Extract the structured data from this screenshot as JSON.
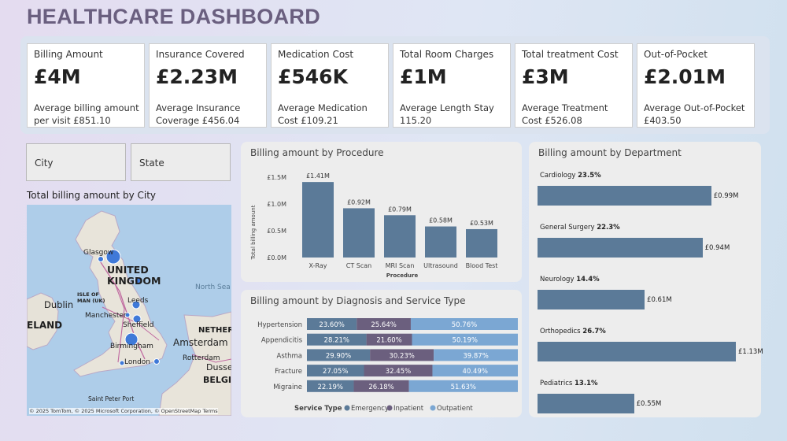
{
  "title": "HEALTHCARE DASHBOARD",
  "colors": {
    "bar": "#5b7a98",
    "emergency": "#5b7a98",
    "inpatient": "#6b5f7e",
    "outpatient": "#7ba7d3"
  },
  "kpis": [
    {
      "label": "Billing Amount",
      "value": "£4M",
      "sub": "Average billing amount per visit £851.10"
    },
    {
      "label": "Insurance Covered",
      "value": "£2.23M",
      "sub": "Average Insurance Coverage £456.04"
    },
    {
      "label": "Medication Cost",
      "value": "£546K",
      "sub": "Average Medication Cost £109.21"
    },
    {
      "label": "Total Room Charges",
      "value": "£1M",
      "sub": "Average Length Stay 115.20"
    },
    {
      "label": "Total treatment Cost",
      "value": "£3M",
      "sub": "Average Treatment Cost £526.08"
    },
    {
      "label": "Out-of-Pocket",
      "value": "£2.01M",
      "sub": "Average Out-of-Pocket £403.50"
    }
  ],
  "slicers": {
    "city": "City",
    "state": "State"
  },
  "map": {
    "title": "Total billing amount by City",
    "country": "UNITED KINGDOM",
    "labels": [
      "Glasgow",
      "Leeds",
      "Manchester",
      "Sheffield",
      "Birmingham",
      "London",
      "Dublin",
      "ISLE OF MAN (UK)",
      "North Sea",
      "NETHER",
      "Amsterdam",
      "Rotterdam",
      "Dusse",
      "BELGI",
      "ELAND",
      "Saint Peter Port"
    ],
    "attribution": "© 2025 TomTom, © 2025 Microsoft Corporation, © OpenStreetMap Terms"
  },
  "procedure_chart": {
    "title": "Billing amount by Procedure",
    "xlabel": "Procedure",
    "ylabel": "Total billing amount",
    "ticks": [
      "£0.0M",
      "£0.5M",
      "£1.0M",
      "£1.5M"
    ],
    "value_labels": [
      "£1.41M",
      "£0.92M",
      "£0.79M",
      "£0.58M",
      "£0.53M"
    ]
  },
  "diagnosis_chart": {
    "title": "Billing amount by Diagnosis and Service Type",
    "legend_title": "Service Type",
    "legend": [
      "Emergency",
      "Inpatient",
      "Outpatient"
    ],
    "rows": [
      {
        "label": "Hypertension",
        "texts": [
          "23.60%",
          "25.64%",
          "50.76%"
        ]
      },
      {
        "label": "Appendicitis",
        "texts": [
          "28.21%",
          "21.60%",
          "50.19%"
        ]
      },
      {
        "label": "Asthma",
        "texts": [
          "29.90%",
          "30.23%",
          "39.87%"
        ]
      },
      {
        "label": "Fracture",
        "texts": [
          "27.05%",
          "32.45%",
          "40.49%"
        ]
      },
      {
        "label": "Migraine",
        "texts": [
          "22.19%",
          "26.18%",
          "51.63%"
        ]
      }
    ]
  },
  "department_chart": {
    "title": "Billing amount by Department",
    "items": [
      {
        "name": "Cardiology",
        "pct": "23.5%",
        "value_label": "£0.99M"
      },
      {
        "name": "General Surgery",
        "pct": "22.3%",
        "value_label": "£0.94M"
      },
      {
        "name": "Neurology",
        "pct": "14.4%",
        "value_label": "£0.61M"
      },
      {
        "name": "Orthopedics",
        "pct": "26.7%",
        "value_label": "£1.13M"
      },
      {
        "name": "Pediatrics",
        "pct": "13.1%",
        "value_label": "£0.55M"
      }
    ]
  },
  "chart_data": [
    {
      "type": "bar",
      "title": "Billing amount by Procedure",
      "xlabel": "Procedure",
      "ylabel": "Total billing amount",
      "categories": [
        "X-Ray",
        "CT Scan",
        "MRI Scan",
        "Ultrasound",
        "Blood Test"
      ],
      "values": [
        1.41,
        0.92,
        0.79,
        0.58,
        0.53
      ],
      "ylim": [
        0,
        1.5
      ]
    },
    {
      "type": "bar",
      "title": "Billing amount by Diagnosis and Service Type",
      "categories": [
        "Hypertension",
        "Appendicitis",
        "Asthma",
        "Fracture",
        "Migraine"
      ],
      "series": [
        {
          "name": "Emergency",
          "values": [
            23.6,
            28.21,
            29.9,
            27.05,
            22.19
          ]
        },
        {
          "name": "Inpatient",
          "values": [
            25.64,
            21.6,
            30.23,
            32.45,
            26.18
          ]
        },
        {
          "name": "Outpatient",
          "values": [
            50.76,
            50.19,
            39.87,
            40.49,
            51.63
          ]
        }
      ]
    },
    {
      "type": "bar",
      "title": "Billing amount by Department",
      "categories": [
        "Cardiology",
        "General Surgery",
        "Neurology",
        "Orthopedics",
        "Pediatrics"
      ],
      "values": [
        0.99,
        0.94,
        0.61,
        1.13,
        0.55
      ]
    }
  ]
}
